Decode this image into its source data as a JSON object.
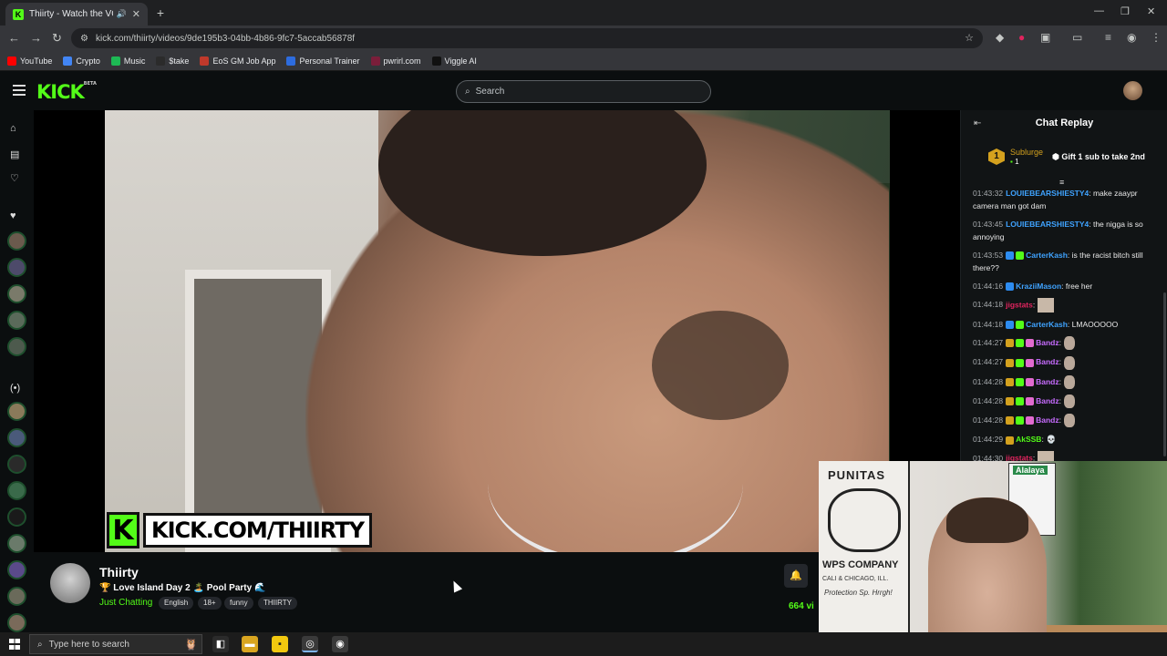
{
  "browser": {
    "tab_title": "Thiirty - Watch the VOD on",
    "tab_favicon": "K",
    "url": "kick.com/thiirty/videos/9de195b3-04bb-4b86-9fc7-5accab56878f",
    "bookmarks": [
      {
        "label": "YouTube",
        "color": "#ff0000",
        "icon": "youtube-icon"
      },
      {
        "label": "Crypto",
        "color": "#4285f4",
        "icon": "globe-icon"
      },
      {
        "label": "Music",
        "color": "#1db954",
        "icon": "spotify-icon"
      },
      {
        "label": "$take",
        "color": "#2b2b2b",
        "icon": "stake-icon"
      },
      {
        "label": "EoS GM Job App",
        "color": "#c0392b",
        "icon": "doc-icon"
      },
      {
        "label": "Personal Trainer",
        "color": "#2d6cdf",
        "icon": "pen-icon"
      },
      {
        "label": "pwrirl.com",
        "color": "#7b1e3a",
        "icon": "site-icon"
      },
      {
        "label": "Viggle AI",
        "color": "#111111",
        "icon": "viggle-icon"
      }
    ]
  },
  "kick": {
    "logo": "KICK",
    "logo_sup": "BETA",
    "search_placeholder": "Search",
    "brand_color": "#53fc18"
  },
  "video": {
    "watermark_k": "K",
    "watermark_text": "KICK.COM/THIIRTY"
  },
  "channel": {
    "name": "Thiirty",
    "title": "🏆 Love Island Day 2 🏝️ Pool Party 🌊",
    "category": "Just Chatting",
    "tags": [
      "English",
      "18+",
      "funny",
      "THIIRTY"
    ],
    "viewers": "664 vi"
  },
  "chat": {
    "header": "Chat Replay",
    "pinned": {
      "rank": "1",
      "user": "Sublurge",
      "count": "1",
      "message": "Gift 1 sub to take 2nd"
    },
    "messages": [
      {
        "time": "01:43:32",
        "user": "LOUIEBEARSHIESTY4",
        "color": "#3fa3ff",
        "text": ": make zaaypr camera man got dam",
        "badges": [],
        "emote": ""
      },
      {
        "time": "01:43:45",
        "user": "LOUIEBEARSHIESTY4",
        "color": "#3fa3ff",
        "text": ": the nigga is so annoying",
        "badges": [],
        "emote": ""
      },
      {
        "time": "01:43:53",
        "user": "CarterKash",
        "color": "#3fa3ff",
        "text": ": is the racist bitch still there??",
        "badges": [
          "#2d8cf0",
          "#53fc18"
        ],
        "emote": ""
      },
      {
        "time": "01:44:16",
        "user": "KraziiMason",
        "color": "#3fa3ff",
        "text": ": free her",
        "badges": [
          "#2d8cf0"
        ],
        "emote": ""
      },
      {
        "time": "01:44:18",
        "user": "jigstats",
        "color": "#e0245e",
        "text": ":",
        "badges": [],
        "emote": "big"
      },
      {
        "time": "01:44:18",
        "user": "CarterKash",
        "color": "#3fa3ff",
        "text": ": LMAOOOOO",
        "badges": [
          "#2d8cf0",
          "#53fc18"
        ],
        "emote": ""
      },
      {
        "time": "01:44:27",
        "user": "Bandz",
        "color": "#c86cff",
        "text": ":",
        "badges": [
          "#d4a11e",
          "#53fc18",
          "#e26ad0"
        ],
        "emote": "face"
      },
      {
        "time": "01:44:27",
        "user": "Bandz",
        "color": "#c86cff",
        "text": ":",
        "badges": [
          "#d4a11e",
          "#53fc18",
          "#e26ad0"
        ],
        "emote": "face"
      },
      {
        "time": "01:44:28",
        "user": "Bandz",
        "color": "#c86cff",
        "text": ":",
        "badges": [
          "#d4a11e",
          "#53fc18",
          "#e26ad0"
        ],
        "emote": "face"
      },
      {
        "time": "01:44:28",
        "user": "Bandz",
        "color": "#c86cff",
        "text": ":",
        "badges": [
          "#d4a11e",
          "#53fc18",
          "#e26ad0"
        ],
        "emote": "face"
      },
      {
        "time": "01:44:28",
        "user": "Bandz",
        "color": "#c86cff",
        "text": ":",
        "badges": [
          "#d4a11e",
          "#53fc18",
          "#e26ad0"
        ],
        "emote": "face"
      },
      {
        "time": "01:44:29",
        "user": "AkSSB",
        "color": "#53fc18",
        "text": ":",
        "badges": [
          "#d4a11e"
        ],
        "emote": "skull"
      },
      {
        "time": "01:44:30",
        "user": "jigstats",
        "color": "#e0245e",
        "text": ":",
        "badges": [],
        "emote": "big"
      }
    ]
  },
  "webcam": {
    "poster_title": "PUNITAS",
    "poster_company": "WPS COMPANY",
    "poster_sub": "CALI & CHICAGO, ILL.",
    "poster_hand": "Protection Sp. Hrrgh!",
    "banner": "Alalaya"
  },
  "taskbar": {
    "search_placeholder": "Type here to search"
  }
}
